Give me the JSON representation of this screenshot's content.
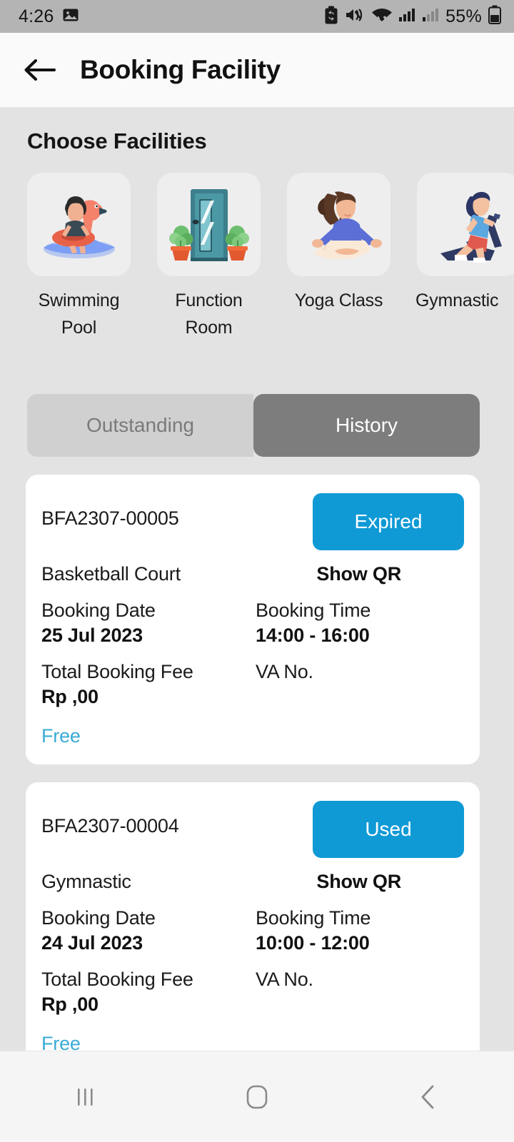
{
  "status_bar": {
    "time": "4:26",
    "battery_percent": "55%",
    "icons": [
      "image-icon",
      "battery-saver-icon",
      "mute-vibrate-icon",
      "wifi-icon",
      "signal-bars-icon",
      "signal-bars-icon-2",
      "battery-icon"
    ]
  },
  "header": {
    "back_icon": "back-arrow-icon",
    "title": "Booking Facility"
  },
  "facilities_section": {
    "title": "Choose Facilities",
    "items": [
      {
        "label": "Swimming\nPool",
        "icon": "swimming-pool-illustration"
      },
      {
        "label": "Function\nRoom",
        "icon": "function-room-illustration"
      },
      {
        "label": "Yoga Class",
        "icon": "yoga-class-illustration"
      },
      {
        "label": "Gymnastic",
        "icon": "gymnastic-illustration"
      }
    ]
  },
  "tabs": {
    "outstanding": "Outstanding",
    "history": "History",
    "active": "History"
  },
  "bookings": [
    {
      "id": "BFA2307-00005",
      "status": "Expired",
      "facility": "Basketball Court",
      "qr_label": "Show QR",
      "date_label": "Booking Date",
      "date_value": "25 Jul 2023",
      "time_label": "Booking Time",
      "time_value": "14:00 - 16:00",
      "fee_label": "Total Booking Fee",
      "fee_value": "Rp  ,00",
      "va_label": "VA No.",
      "va_value": "",
      "free_tag": "Free"
    },
    {
      "id": "BFA2307-00004",
      "status": "Used",
      "facility": "Gymnastic",
      "qr_label": "Show QR",
      "date_label": "Booking Date",
      "date_value": "24 Jul 2023",
      "time_label": "Booking Time",
      "time_value": "10:00 - 12:00",
      "fee_label": "Total Booking Fee",
      "fee_value": "Rp  ,00",
      "va_label": "VA No.",
      "va_value": "",
      "free_tag": "Free"
    }
  ],
  "nav_bar": {
    "recents": "recents-icon",
    "home": "home-icon",
    "back": "back-icon"
  },
  "colors": {
    "badge_blue": "#0f9ad6",
    "free_blue": "#3aabd6",
    "tab_active": "#7d7d7d",
    "tab_inactive": "#d0d0d0",
    "page_bg": "#e3e3e3",
    "card_bg": "#ffffff",
    "status_bar_bg": "#b4b4b4"
  }
}
